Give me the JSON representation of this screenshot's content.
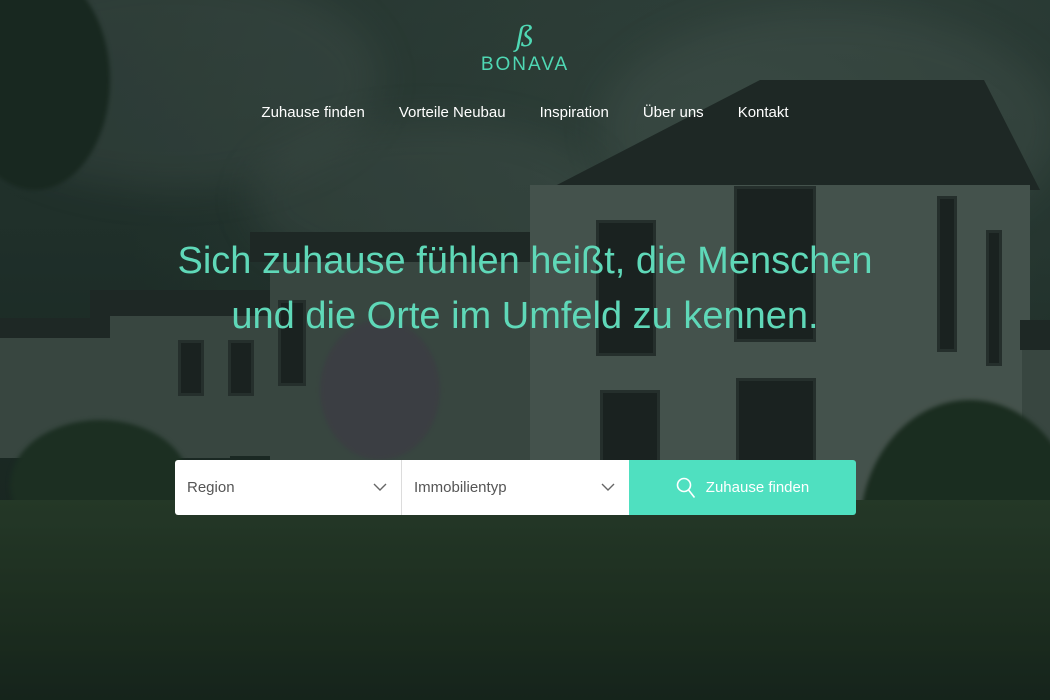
{
  "brand": {
    "name": "BONAVA",
    "mark": "ß",
    "accent_color": "#4fd8b4"
  },
  "nav": {
    "items": [
      {
        "label": "Zuhause finden"
      },
      {
        "label": "Vorteile Neubau"
      },
      {
        "label": "Inspiration"
      },
      {
        "label": "Über uns"
      },
      {
        "label": "Kontakt"
      }
    ]
  },
  "hero": {
    "headline": "Sich zuhause fühlen heißt, die Menschen und die Orte im Umfeld zu kennen."
  },
  "search": {
    "region": {
      "label": "Region",
      "icon": "chevron-down-icon"
    },
    "type": {
      "label": "Immobilientyp",
      "icon": "chevron-down-icon"
    },
    "submit": {
      "label": "Zuhause finden",
      "icon": "search-icon",
      "color": "#4fe0c0"
    }
  }
}
